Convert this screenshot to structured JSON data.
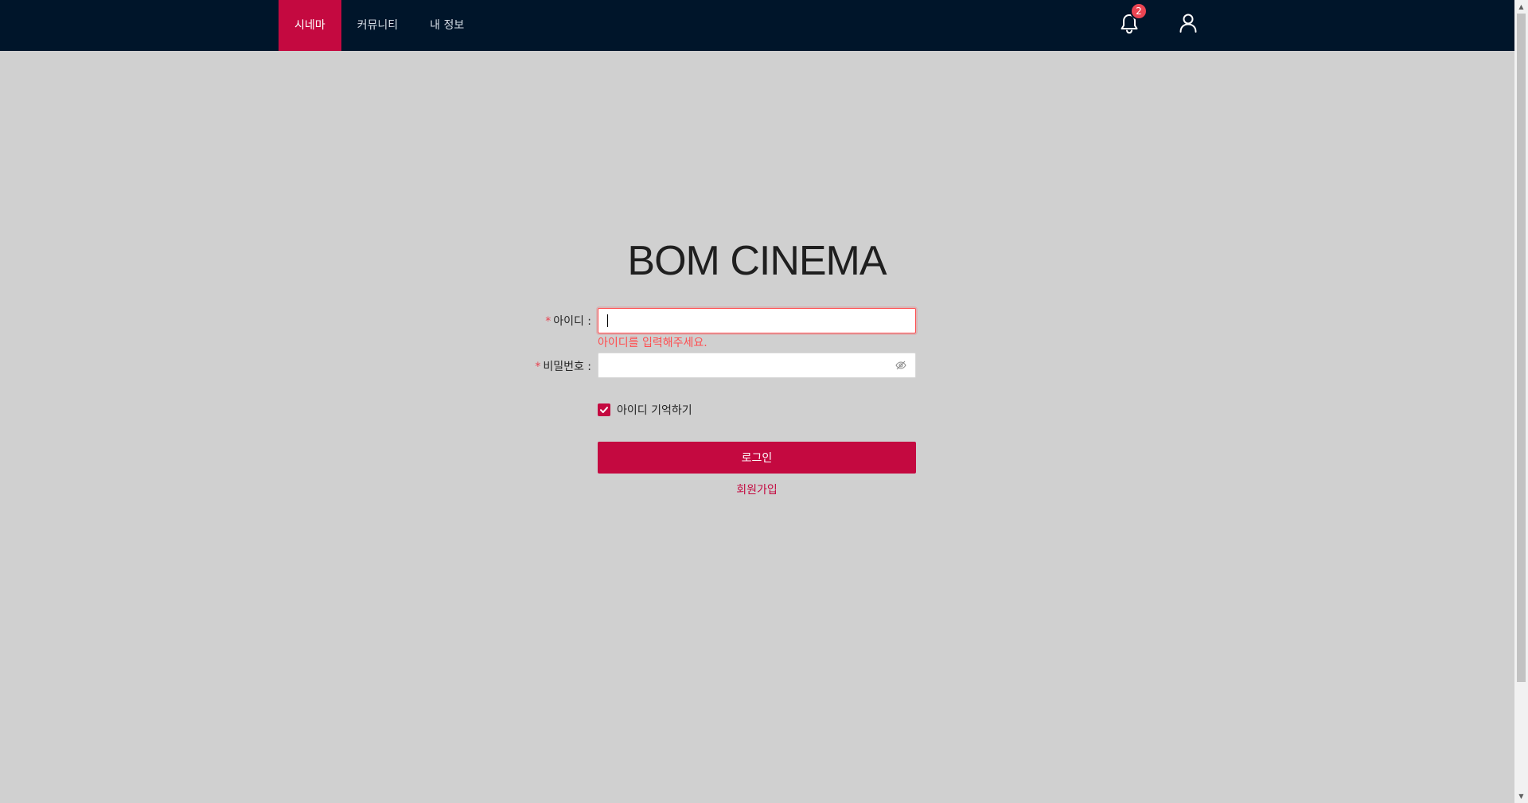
{
  "nav": {
    "items": [
      {
        "label": "시네마",
        "active": true
      },
      {
        "label": "커뮤니티",
        "active": false
      },
      {
        "label": "내 정보",
        "active": false
      }
    ],
    "notifications": {
      "icon": "bell-icon",
      "count": "2"
    },
    "user": {
      "icon": "user-icon"
    }
  },
  "login": {
    "title": "BOM CINEMA",
    "id_field": {
      "required_mark": "*",
      "label": "아이디 :",
      "value": "",
      "error": "아이디를 입력해주세요."
    },
    "password_field": {
      "required_mark": "*",
      "label": "비밀번호 :",
      "value": "",
      "toggle_icon": "eye-invisible-icon"
    },
    "remember": {
      "label": "아이디 기억하기",
      "checked": true
    },
    "submit_label": "로그인",
    "signup_label": "회원가입"
  },
  "colors": {
    "header_bg": "#00152a",
    "brand": "#c40940",
    "page_bg": "#d0d0d0",
    "error": "#ff4d4f",
    "badge": "#ea4452"
  }
}
